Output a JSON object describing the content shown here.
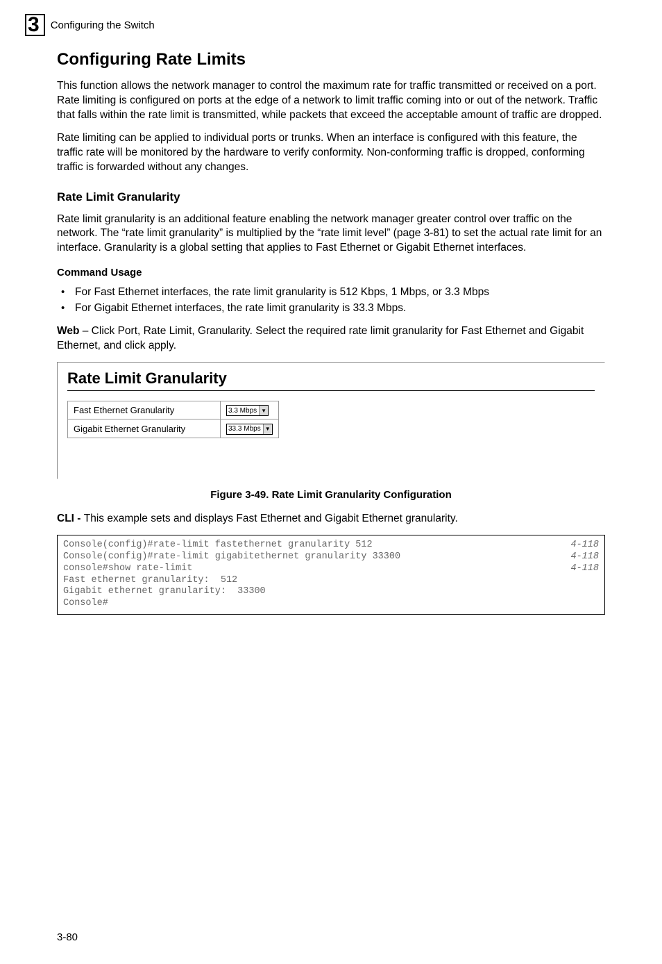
{
  "header": {
    "chapter_number": "3",
    "section": "Configuring the Switch"
  },
  "h1": "Configuring Rate Limits",
  "para1": "This function allows the network manager to control the maximum rate for traffic transmitted or received on a port. Rate limiting is configured on ports at the edge of a network to limit traffic coming into or out of the network. Traffic that falls within the rate limit is transmitted, while packets that exceed the acceptable amount of traffic are dropped.",
  "para2": "Rate limiting can be applied to individual ports or trunks. When an interface is configured with this feature, the traffic rate will be monitored by the hardware to verify conformity. Non-conforming traffic is dropped, conforming traffic is forwarded without any changes.",
  "h2": "Rate Limit Granularity",
  "para3": "Rate limit granularity is an additional feature enabling the network manager greater control over traffic on the network. The “rate limit granularity” is multiplied by the “rate limit level” (page 3-81) to set the actual rate limit for an interface. Granularity is a global setting that applies to Fast Ethernet or Gigabit Ethernet interfaces.",
  "h3_usage": "Command Usage",
  "bullets": [
    "For Fast Ethernet interfaces, the rate limit granularity is 512 Kbps, 1 Mbps, or 3.3 Mbps",
    "For Gigabit Ethernet interfaces, the rate limit granularity is 33.3 Mbps."
  ],
  "web_bold": "Web",
  "web_text": " – Click Port, Rate Limit, Granularity. Select the required rate limit granularity for Fast Ethernet and Gigabit Ethernet, and click apply.",
  "panel": {
    "title": "Rate Limit Granularity",
    "rows": [
      {
        "label": "Fast Ethernet Granularity",
        "value": "3.3 Mbps"
      },
      {
        "label": "Gigabit Ethernet Granularity",
        "value": "33.3 Mbps"
      }
    ]
  },
  "figure_caption": "Figure 3-49.  Rate Limit Granularity Configuration",
  "cli_bold": "CLI - ",
  "cli_text": "This example sets and displays Fast Ethernet and Gigabit Ethernet granularity.",
  "cli_lines": [
    {
      "cmd": "Console(config)#rate-limit fastethernet granularity 512",
      "ref": "4-118"
    },
    {
      "cmd": "Console(config)#rate-limit gigabitethernet granularity 33300",
      "ref": "4-118"
    },
    {
      "cmd": "console#show rate-limit",
      "ref": "4-118"
    },
    {
      "cmd": "",
      "ref": ""
    },
    {
      "cmd": "Fast ethernet granularity:  512",
      "ref": ""
    },
    {
      "cmd": "",
      "ref": ""
    },
    {
      "cmd": "Gigabit ethernet granularity:  33300",
      "ref": ""
    },
    {
      "cmd": "Console#",
      "ref": ""
    }
  ],
  "page_number": "3-80"
}
